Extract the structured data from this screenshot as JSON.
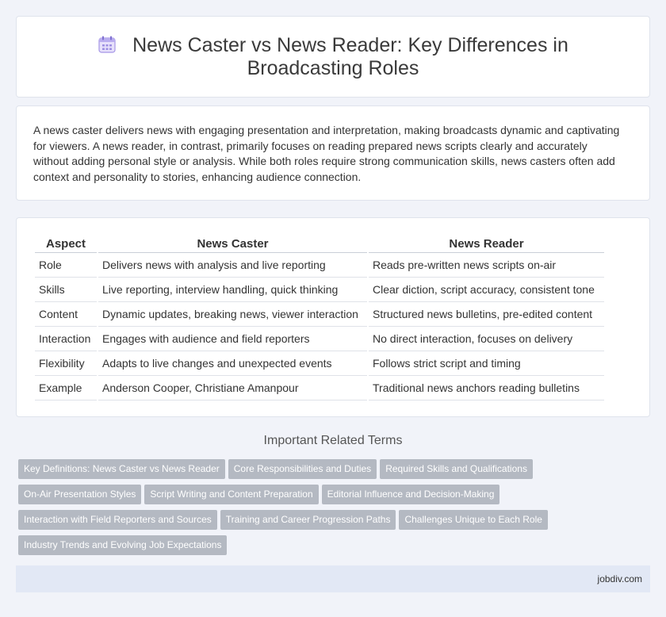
{
  "page": {
    "title": "News Caster vs News Reader: Key Differences in Broadcasting Roles",
    "title_icon": "calendar-icon",
    "intro": "A news caster delivers news with engaging presentation and interpretation, making broadcasts dynamic and captivating for viewers. A news reader, in contrast, primarily focuses on reading prepared news scripts clearly and accurately without adding personal style or analysis. While both roles require strong communication skills, news casters often add context and personality to stories, enhancing audience connection."
  },
  "table": {
    "headers": [
      "Aspect",
      "News Caster",
      "News Reader"
    ],
    "rows": [
      [
        "Role",
        "Delivers news with analysis and live reporting",
        "Reads pre-written news scripts on-air"
      ],
      [
        "Skills",
        "Live reporting, interview handling, quick thinking",
        "Clear diction, script accuracy, consistent tone"
      ],
      [
        "Content",
        "Dynamic updates, breaking news, viewer interaction",
        "Structured news bulletins, pre-edited content"
      ],
      [
        "Interaction",
        "Engages with audience and field reporters",
        "No direct interaction, focuses on delivery"
      ],
      [
        "Flexibility",
        "Adapts to live changes and unexpected events",
        "Follows strict script and timing"
      ],
      [
        "Example",
        "Anderson Cooper, Christiane Amanpour",
        "Traditional news anchors reading bulletins"
      ]
    ]
  },
  "related": {
    "heading": "Important Related Terms",
    "tags": [
      "Key Definitions: News Caster vs News Reader",
      "Core Responsibilities and Duties",
      "Required Skills and Qualifications",
      "On-Air Presentation Styles",
      "Script Writing and Content Preparation",
      "Editorial Influence and Decision-Making",
      "Interaction with Field Reporters and Sources",
      "Training and Career Progression Paths",
      "Challenges Unique to Each Role",
      "Industry Trends and Evolving Job Expectations"
    ]
  },
  "footer": {
    "site": "jobdiv.com"
  },
  "colors": {
    "background": "#f1f3f9",
    "tag_bg": "#b4b9c2",
    "footer_bg": "#e2e8f5",
    "icon_accent": "#8f7fd6"
  }
}
